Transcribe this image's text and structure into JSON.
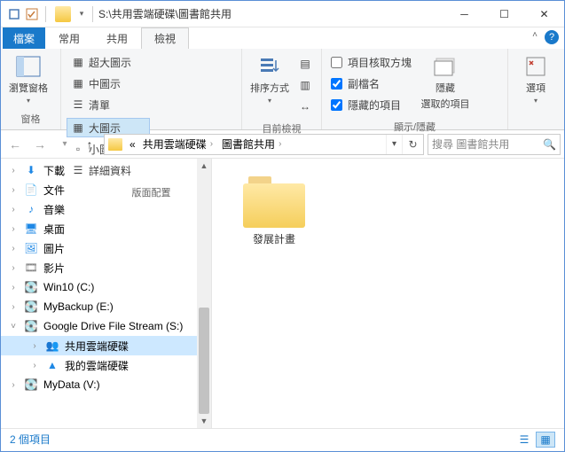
{
  "window": {
    "title": "S:\\共用雲端硬碟\\圖書館共用"
  },
  "tabs": {
    "file": "檔案",
    "home": "常用",
    "share": "共用",
    "view": "檢視"
  },
  "ribbon": {
    "preview_pane_label": "瀏覽窗格",
    "group_panes": "窗格",
    "layout": {
      "extra_large": "超大圖示",
      "large": "大圖示",
      "medium": "中圖示",
      "small": "小圖示",
      "list": "清單",
      "details": "詳細資料"
    },
    "group_layout": "版面配置",
    "sort_label": "排序方式",
    "group_current": "目前檢視",
    "show": {
      "checkboxes": "項目核取方塊",
      "extensions": "副檔名",
      "hidden": "隱藏的項目"
    },
    "hide_btn_line1": "隱藏",
    "hide_btn_line2": "選取的項目",
    "group_show": "顯示/隱藏",
    "options_label": "選項"
  },
  "address": {
    "crumb1": "共用雲端硬碟",
    "crumb2": "圖書館共用",
    "search_placeholder": "搜尋 圖書館共用"
  },
  "tree": {
    "downloads": "下載",
    "documents": "文件",
    "music": "音樂",
    "desktop": "桌面",
    "pictures": "圖片",
    "videos": "影片",
    "win10": "Win10 (C:)",
    "mybackup": "MyBackup (E:)",
    "gdrive": "Google Drive File Stream (S:)",
    "shared_drive": "共用雲端硬碟",
    "my_drive": "我的雲端硬碟",
    "mydata": "MyData (V:)"
  },
  "content": {
    "item1": "發展計畫"
  },
  "status": {
    "count": "2 個項目"
  }
}
